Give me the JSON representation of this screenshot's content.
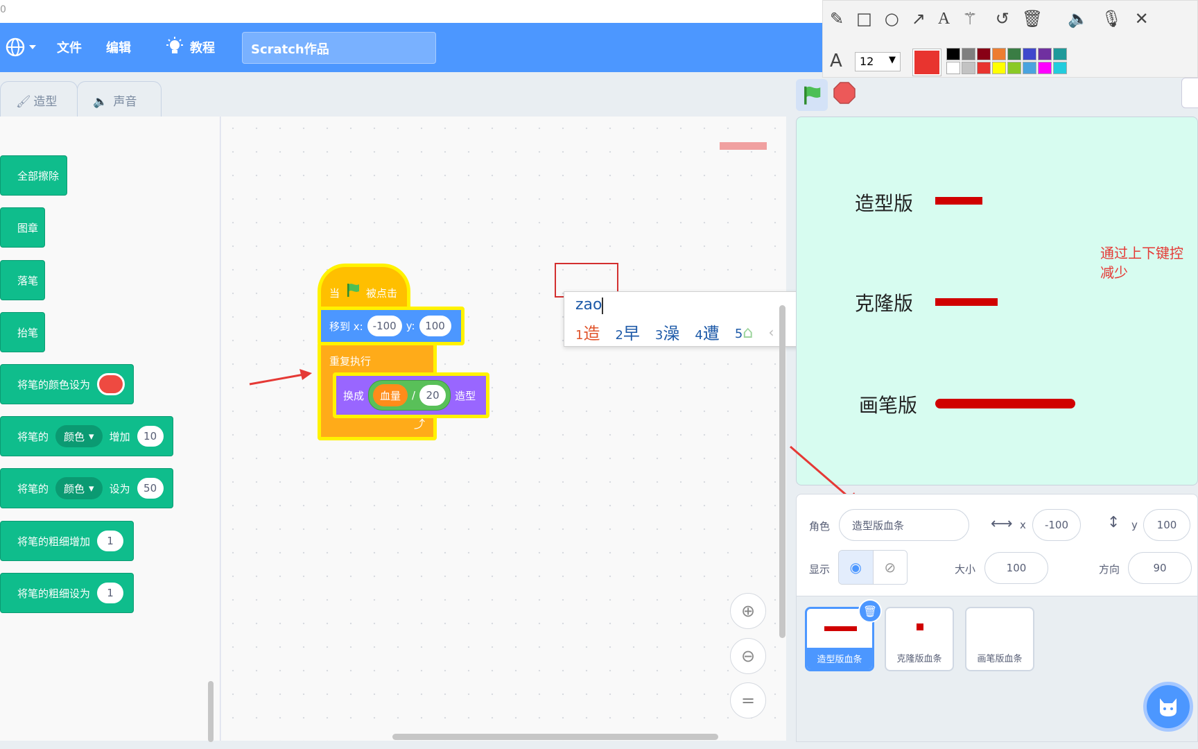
{
  "top_strip_text": "0",
  "menubar": {
    "file": "文件",
    "edit": "编辑",
    "tutorial": "教程",
    "project_title": "Scratch作品"
  },
  "tabs": {
    "costumes": "造型",
    "sounds": "声音"
  },
  "palette": {
    "clear": "全部擦除",
    "stamp": "图章",
    "pen_down": "落笔",
    "pen_up": "抬笔",
    "set_color_to": "将笔的颜色设为",
    "change_param_prefix": "将笔的",
    "change_param_dd": "颜色",
    "change_param_mid": "增加",
    "change_param_val": "10",
    "set_param_prefix": "将笔的",
    "set_param_dd": "颜色",
    "set_param_mid": "设为",
    "set_param_val": "50",
    "change_size": "将笔的粗细增加",
    "change_size_val": "1",
    "set_size": "将笔的粗细设为",
    "set_size_val": "1"
  },
  "script": {
    "hat_when": "当",
    "hat_clicked": "被点击",
    "goto_label": "移到 x:",
    "goto_x": "-100",
    "goto_y_label": "y:",
    "goto_y": "100",
    "forever": "重复执行",
    "switch_label": "换成",
    "var_name": "血量",
    "divide": "/",
    "divisor": "20",
    "costume_suffix": "造型"
  },
  "ime": {
    "input": "zao",
    "candidates": [
      {
        "num": "1",
        "char": "造"
      },
      {
        "num": "2",
        "char": "早"
      },
      {
        "num": "3",
        "char": "澡"
      },
      {
        "num": "4",
        "char": "遭"
      },
      {
        "num": "5",
        "char": ""
      }
    ]
  },
  "stage": {
    "label_costume": "造型版",
    "label_clone": "克隆版",
    "label_pen": "画笔版",
    "note_line1": "通过上下键控",
    "note_line2": "减少"
  },
  "sprite_info": {
    "sprite_label": "角色",
    "sprite_name": "造型版血条",
    "x_label": "x",
    "x": "-100",
    "y_label": "y",
    "y": "100",
    "show_label": "显示",
    "size_label": "大小",
    "size": "100",
    "direction_label": "方向",
    "direction": "90"
  },
  "sprites": [
    "造型版血条",
    "克隆版血条",
    "画笔版血条"
  ],
  "annotation_toolbar": {
    "font_size": "12",
    "current_color": "#e8342f",
    "swatches_row1": [
      "#000000",
      "#7f7f7f",
      "#880015",
      "#ed7d31",
      "#3a7d44",
      "#3f48cc",
      "#7030a0",
      "#1f9a9a"
    ],
    "swatches_row2": [
      "#ffffff",
      "#c3c3c3",
      "#e8342f",
      "#ffff00",
      "#8ac926",
      "#4aa3df",
      "#ff00ff",
      "#22ccdd"
    ]
  },
  "colors": {
    "scratch_blue": "#4c97ff",
    "pen_green": "#0fbd8c",
    "event_yellow": "#ffbf00",
    "motion_blue": "#4c97ff",
    "looks_purple": "#9966ff",
    "variable_orange": "#ff8c1a",
    "operator_green": "#59c059",
    "stop_red": "#ec5959"
  }
}
